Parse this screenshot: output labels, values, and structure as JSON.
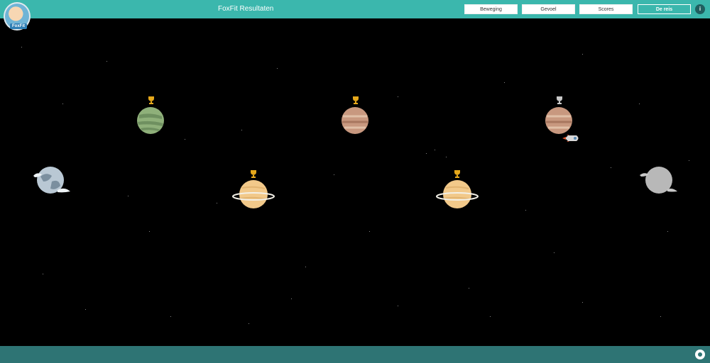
{
  "header": {
    "title": "FoxFit Resultaten",
    "logo_text": "FoxFit",
    "nav": [
      {
        "label": "Beweging",
        "active": false
      },
      {
        "label": "Gevoel",
        "active": false
      },
      {
        "label": "Scores",
        "active": false
      },
      {
        "label": "De reis",
        "active": true
      }
    ],
    "info_label": "i"
  },
  "colors": {
    "header": "#3bb7ad",
    "footer": "#2e7474",
    "background": "#000000",
    "gold_trophy": "#e6a81b",
    "silver_trophy": "#c9c9c9"
  },
  "journey": {
    "planets": [
      {
        "name": "earth",
        "trophy": "none"
      },
      {
        "name": "green-planet",
        "trophy": "gold"
      },
      {
        "name": "saturn-1",
        "trophy": "gold"
      },
      {
        "name": "jupiter-1",
        "trophy": "gold"
      },
      {
        "name": "saturn-2",
        "trophy": "gold"
      },
      {
        "name": "jupiter-2",
        "trophy": "silver",
        "has_rocket": true
      },
      {
        "name": "locked-planet",
        "trophy": "none",
        "locked": true
      }
    ]
  },
  "footer": {
    "icon": "github-icon"
  }
}
